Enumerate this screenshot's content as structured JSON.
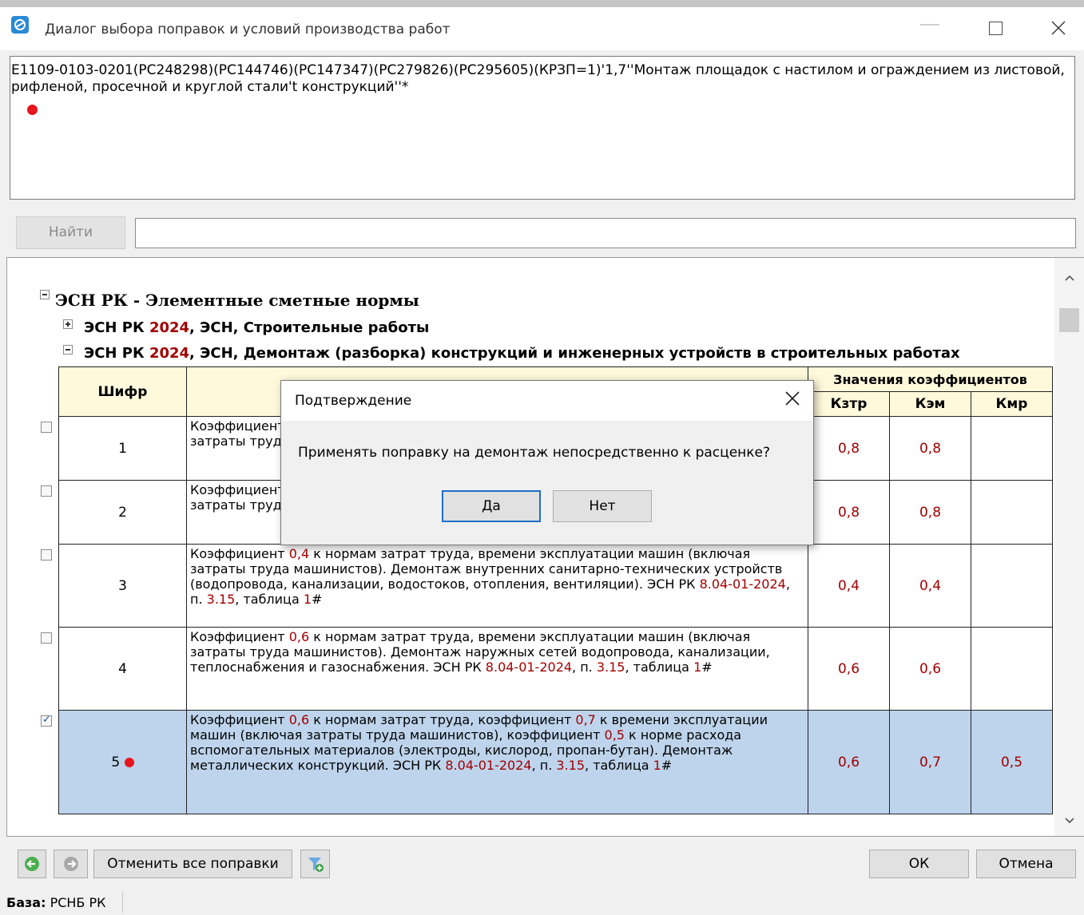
{
  "window": {
    "title": "Диалог выбора поправок и условий производства работ"
  },
  "formula": {
    "text": "Е1109-0103-0201(РС248298)(РС144746)(РС147347)(РС279826)(РС295605)(КРЗП=1)'1,7''Монтаж площадок с настилом и ограждением из листовой, рифленой, просечной и круглой стали't конструкций''*"
  },
  "search": {
    "button_label": "Найти",
    "value": ""
  },
  "tree": {
    "root_label": "ЭСН РК - Элементные сметные нормы",
    "nodes": [
      {
        "pre": "ЭСН РК ",
        "year": "2024",
        "post": ", ЭСН, Строительные работы",
        "expanded": false
      },
      {
        "pre": "ЭСН РК ",
        "year": "2024",
        "post": ", ЭСН, Демонтаж (разборка) конструкций и инженерных устройств в строительных работах",
        "expanded": true
      }
    ]
  },
  "table": {
    "code_header": "Шифр",
    "coef_group_header": "Значения коэффициентов",
    "col_headers": [
      "Кзтр",
      "Кэм",
      "Кмр"
    ],
    "rows": [
      {
        "code": "1",
        "checked": false,
        "selected": false,
        "desc": "Коэффициент 0,8 к нормам затрат труда, времени эксплуатации машин (включая затраты труда машинистов). Демонтаж сборных бетонных конструкций.",
        "k1": "0,8",
        "k2": "0,8",
        "k3": ""
      },
      {
        "code": "2",
        "checked": false,
        "selected": false,
        "desc": "Коэффициент 0,8 к нормам затрат труда, времени эксплуатации машин (включая затраты труда машинистов). Демонтаж деревянных конструкций.",
        "k1": "0,8",
        "k2": "0,8",
        "k3": ""
      },
      {
        "code": "3",
        "checked": false,
        "selected": false,
        "desc": "Коэффициент 0,4 к нормам затрат труда, времени эксплуатации машин (включая затраты труда машинистов). Демонтаж внутренних санитарно-технических устройств (водопровода, канализации, водостоков, отопления, вентиляции). ЭСН РК 8.04-01-2024, п. 3.15, таблица 1#",
        "k1": "0,4",
        "k2": "0,4",
        "k3": ""
      },
      {
        "code": "4",
        "checked": false,
        "selected": false,
        "desc": "Коэффициент 0,6 к нормам затрат труда, времени эксплуатации машин (включая затраты труда машинистов). Демонтаж наружных сетей водопровода, канализации, теплоснабжения и газоснабжения. ЭСН РК 8.04-01-2024, п. 3.15, таблица 1#",
        "k1": "0,6",
        "k2": "0,6",
        "k3": ""
      },
      {
        "code": "5",
        "checked": true,
        "selected": true,
        "desc": "Коэффициент 0,6 к нормам затрат труда, коэффициент 0,7 к времени эксплуатации машин (включая затраты труда машинистов), коэффициент 0,5 к норме расхода вспомогательных материалов (электроды, кислород, пропан-бутан). Демонтаж металлических конструкций. ЭСН РК 8.04-01-2024, п. 3.15, таблица 1#",
        "k1": "0,6",
        "k2": "0,7",
        "k3": "0,5"
      }
    ]
  },
  "dialog": {
    "title": "Подтверждение",
    "message": "Применять поправку на демонтаж непосредственно к расценке?",
    "yes_label": "Да",
    "no_label": "Нет"
  },
  "toolbar": {
    "cancel_all_label": "Отменить все поправки",
    "ok_label": "ОК",
    "cancel_label": "Отмена"
  },
  "status": {
    "base_label": "База:",
    "base_value": "РСНБ РК"
  },
  "colors": {
    "accent_red": "#a10000",
    "selection": "#bed4ec",
    "header_bg": "#fff9dc",
    "dialog_focus": "#1b6fc8"
  },
  "icons": [
    "app-icon",
    "minimize-icon",
    "maximize-icon",
    "close-icon",
    "expand-icon",
    "collapse-icon",
    "undo-icon",
    "redo-icon",
    "filter-add-icon",
    "chevron-up-icon",
    "chevron-down-icon"
  ]
}
